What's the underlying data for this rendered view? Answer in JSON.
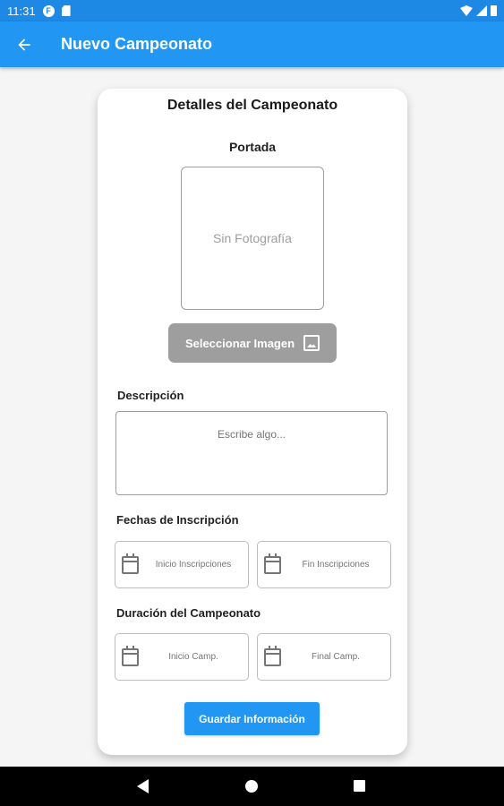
{
  "status_bar": {
    "time": "11:31",
    "icons": [
      "app-notification-icon",
      "sd-card-icon",
      "wifi-icon",
      "signal-icon",
      "battery-icon"
    ]
  },
  "app_bar": {
    "title": "Nuevo Campeonato",
    "back_icon": "arrow-back-icon",
    "background": "#2196f3"
  },
  "card": {
    "title": "Detalles del Campeonato",
    "cover": {
      "label": "Portada",
      "placeholder": "Sin Fotografía"
    },
    "select_image_button": "Seleccionar Imagen",
    "description": {
      "label": "Descripción",
      "placeholder": "Escribe algo..."
    },
    "registration_dates": {
      "label": "Fechas de Inscripción",
      "start": "Inicio Inscripciones",
      "end": "Fin Inscripciones"
    },
    "championship_duration": {
      "label": "Duración del Campeonato",
      "start": "Inicio Camp.",
      "end": "Final Camp."
    },
    "save_button": "Guardar Información"
  },
  "colors": {
    "primary": "#2196f3",
    "disabled_button": "#9e9e9e",
    "navigation_bar": "#000000"
  }
}
